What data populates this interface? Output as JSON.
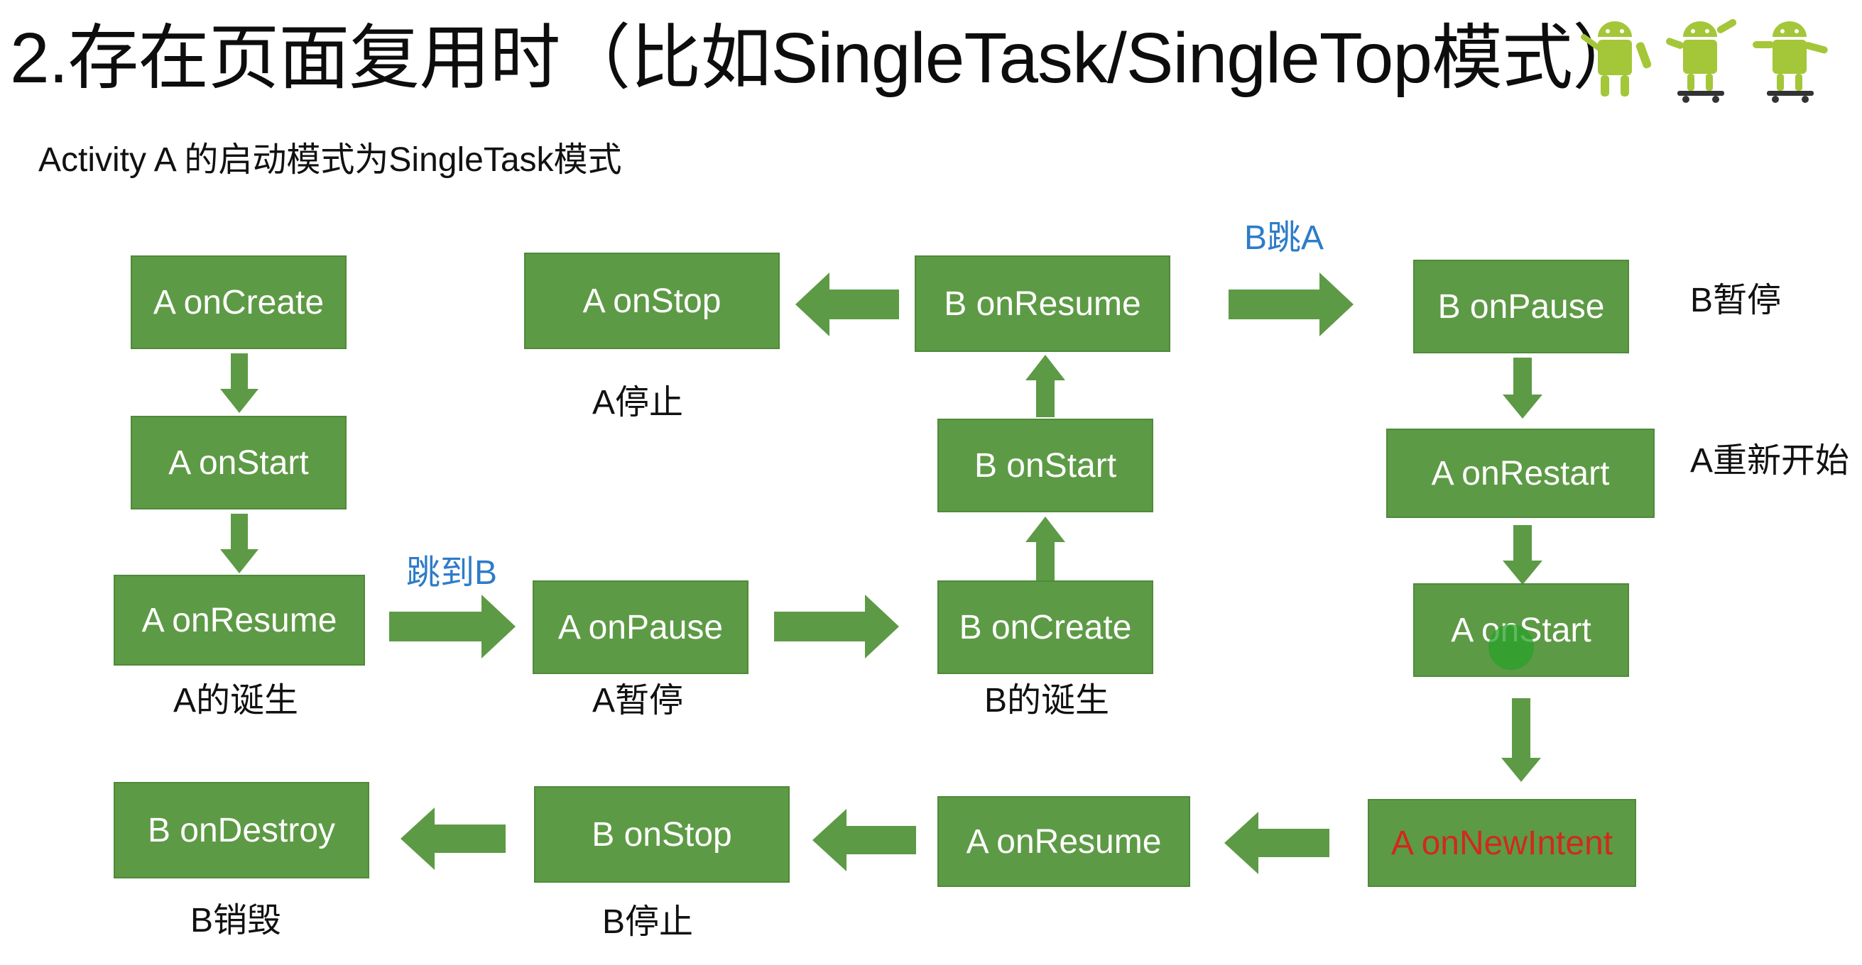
{
  "title": "2.存在页面复用时（比如SingleTask/SingleTop模式）",
  "subtitle": "Activity A 的启动模式为SingleTask模式",
  "colors": {
    "box_fill": "#5d9a45",
    "box_text": "#ffffff",
    "highlight_text": "#d02a1a",
    "jump_label": "#2e7cc8"
  },
  "icons": [
    "android-robot-icon",
    "android-skateboard-icon",
    "android-skateboard-icon"
  ],
  "boxes": {
    "a_oncreate": "A onCreate",
    "a_onstart": "A onStart",
    "a_onresume": "A onResume",
    "a_onpause": "A onPause",
    "b_oncreate": "B onCreate",
    "b_onstart": "B onStart",
    "b_onresume": "B onResume",
    "a_onstop": "A onStop",
    "b_onpause": "B onPause",
    "a_onrestart": "A onRestart",
    "a_onstart2": "A onStart",
    "a_onnewintent": "A onNewIntent",
    "a_onresume2": "A onResume",
    "b_onstop": "B onStop",
    "b_ondestroy": "B onDestroy"
  },
  "captions": {
    "a_birth": "A的诞生",
    "a_pause": "A暂停",
    "b_birth": "B的诞生",
    "a_stop": "A停止",
    "b_pause": "B暂停",
    "a_restart": "A重新开始",
    "b_stop": "B停止",
    "b_destroy": "B销毁"
  },
  "jumps": {
    "to_b": "跳到B",
    "b_to_a": "B跳A"
  }
}
